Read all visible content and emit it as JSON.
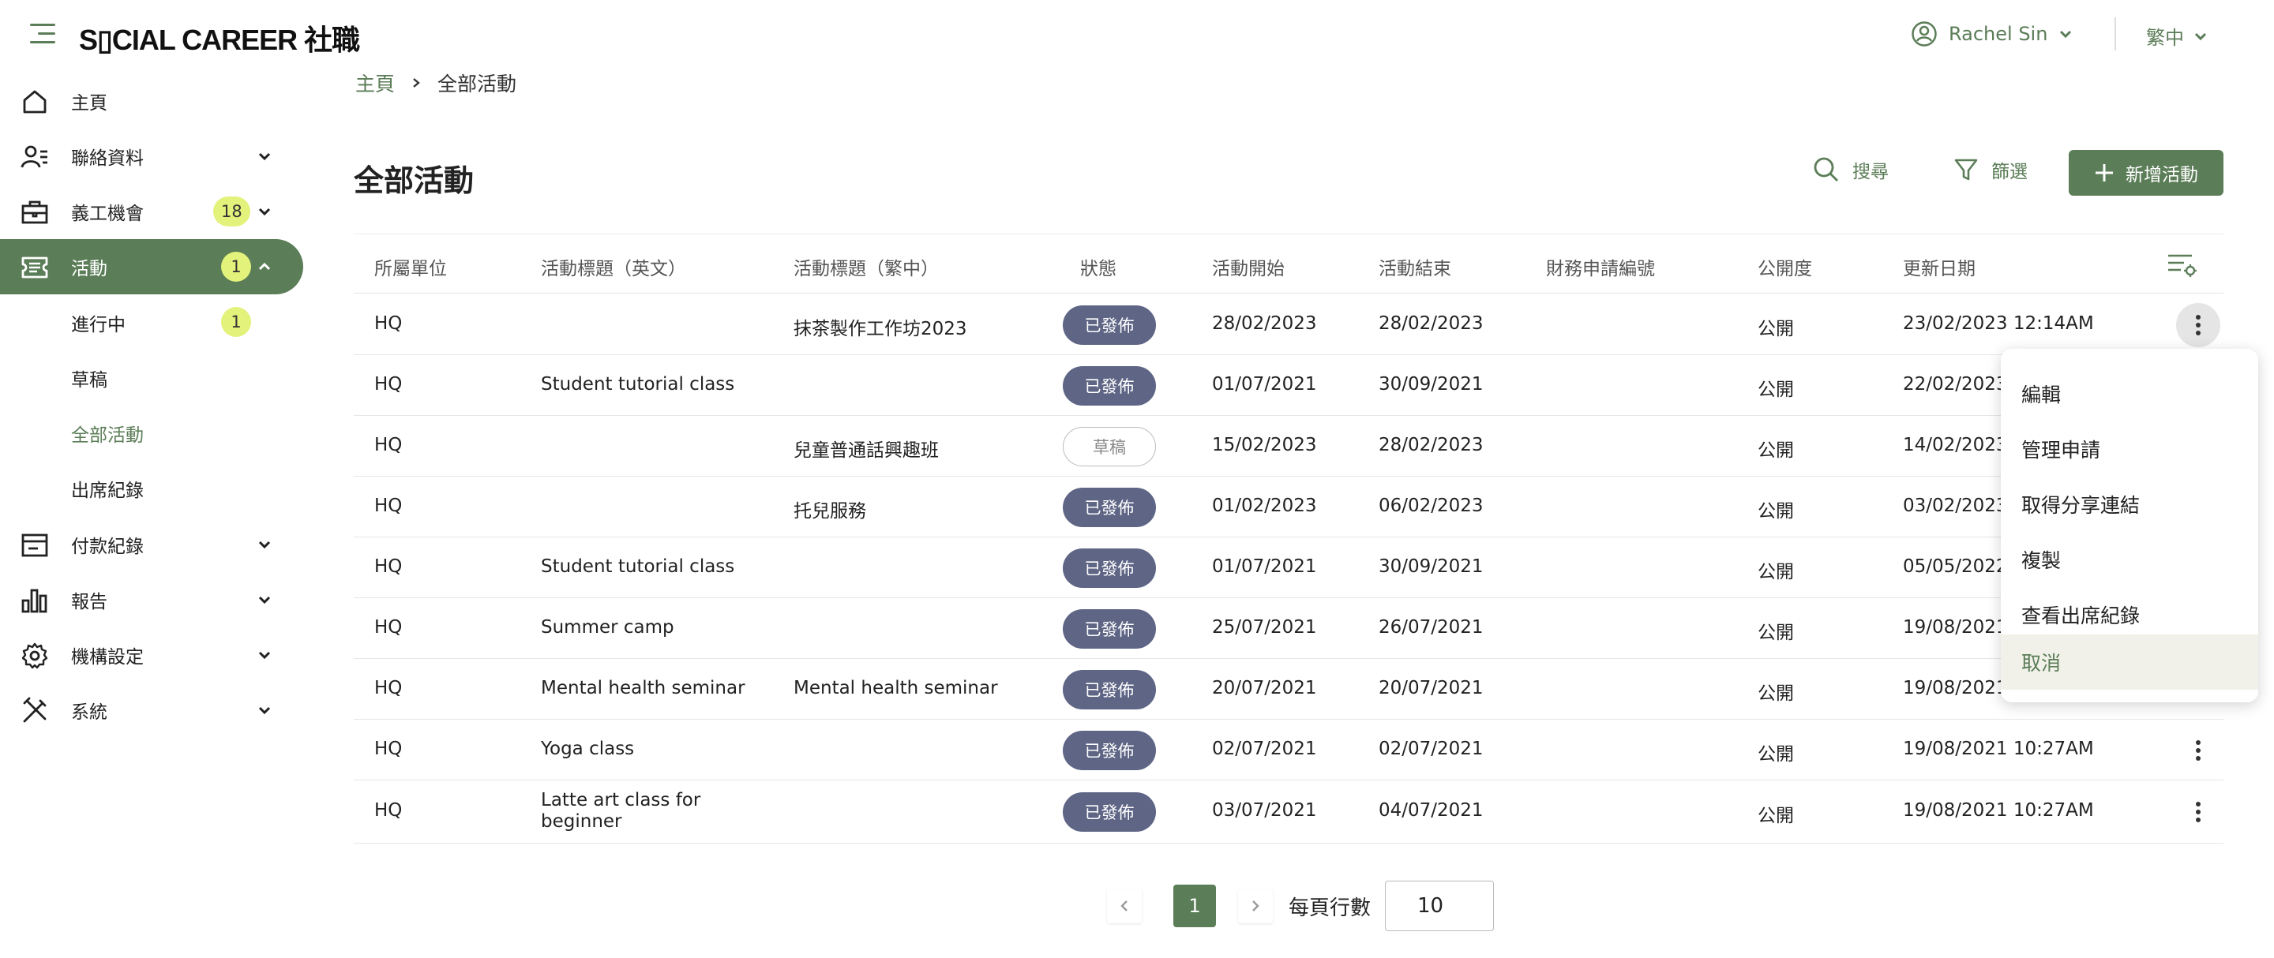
{
  "app": {
    "logo": "S▯CIAL CAREER 社職"
  },
  "user": {
    "name": "Rachel Sin",
    "language": "繁中"
  },
  "sidebar": {
    "items": [
      {
        "label": "主頁",
        "icon": "home-icon"
      },
      {
        "label": "聯絡資料",
        "icon": "contacts-icon"
      },
      {
        "label": "義工機會",
        "icon": "briefcase-icon",
        "count": "18"
      },
      {
        "label": "活動",
        "icon": "ticket-icon",
        "count": "1"
      },
      {
        "label": "付款紀錄",
        "icon": "payment-icon"
      },
      {
        "label": "報告",
        "icon": "chart-icon"
      },
      {
        "label": "機構設定",
        "icon": "gear-icon"
      },
      {
        "label": "系統",
        "icon": "tools-icon"
      }
    ],
    "sub_items": [
      {
        "label": "進行中",
        "count": "1"
      },
      {
        "label": "草稿"
      },
      {
        "label": "全部活動"
      },
      {
        "label": "出席紀錄"
      }
    ]
  },
  "breadcrumb": {
    "home": "主頁",
    "current": "全部活動"
  },
  "header": {
    "title": "全部活動",
    "search": "搜尋",
    "filter": "篩選",
    "add": "新增活動"
  },
  "table": {
    "columns": [
      "所屬單位",
      "活動標題（英文）",
      "活動標題（繁中）",
      "狀態",
      "活動開始",
      "活動結束",
      "財務申請編號",
      "公開度",
      "更新日期"
    ],
    "rows": [
      {
        "unit": "HQ",
        "title_en": "",
        "title_zh": "抹茶製作工作坊2023",
        "status": "已發佈",
        "start": "28/02/2023",
        "end": "28/02/2023",
        "finance": "",
        "visibility": "公開",
        "updated": "23/02/2023 12:14AM"
      },
      {
        "unit": "HQ",
        "title_en": "Student tutorial class",
        "title_zh": "",
        "status": "已發佈",
        "start": "01/07/2021",
        "end": "30/09/2021",
        "finance": "",
        "visibility": "公開",
        "updated": "22/02/2023"
      },
      {
        "unit": "HQ",
        "title_en": "",
        "title_zh": "兒童普通話興趣班",
        "status": "草稿",
        "start": "15/02/2023",
        "end": "28/02/2023",
        "finance": "",
        "visibility": "公開",
        "updated": "14/02/2023"
      },
      {
        "unit": "HQ",
        "title_en": "",
        "title_zh": "托兒服務",
        "status": "已發佈",
        "start": "01/02/2023",
        "end": "06/02/2023",
        "finance": "",
        "visibility": "公開",
        "updated": "03/02/2023"
      },
      {
        "unit": "HQ",
        "title_en": "Student tutorial class",
        "title_zh": "",
        "status": "已發佈",
        "start": "01/07/2021",
        "end": "30/09/2021",
        "finance": "",
        "visibility": "公開",
        "updated": "05/05/2022"
      },
      {
        "unit": "HQ",
        "title_en": "Summer camp",
        "title_zh": "",
        "status": "已發佈",
        "start": "25/07/2021",
        "end": "26/07/2021",
        "finance": "",
        "visibility": "公開",
        "updated": "19/08/2021"
      },
      {
        "unit": "HQ",
        "title_en": "Mental health seminar",
        "title_zh": "Mental health seminar",
        "status": "已發佈",
        "start": "20/07/2021",
        "end": "20/07/2021",
        "finance": "",
        "visibility": "公開",
        "updated": "19/08/2021"
      },
      {
        "unit": "HQ",
        "title_en": "Yoga class",
        "title_zh": "",
        "status": "已發佈",
        "start": "02/07/2021",
        "end": "02/07/2021",
        "finance": "",
        "visibility": "公開",
        "updated": "19/08/2021 10:27AM"
      },
      {
        "unit": "HQ",
        "title_en": "Latte art class for beginner",
        "title_zh": "",
        "status": "已發佈",
        "start": "03/07/2021",
        "end": "04/07/2021",
        "finance": "",
        "visibility": "公開",
        "updated": "19/08/2021 10:27AM"
      }
    ]
  },
  "context_menu": {
    "items": [
      "編輯",
      "管理申請",
      "取得分享連結",
      "複製",
      "查看出席紀錄",
      "取消"
    ]
  },
  "pagination": {
    "current_page": "1",
    "rows_label": "每頁行數",
    "rows_per_page": "10"
  },
  "colors": {
    "primary": "#5b7d57",
    "badge": "#e2f27a",
    "published": "#5e6585"
  }
}
